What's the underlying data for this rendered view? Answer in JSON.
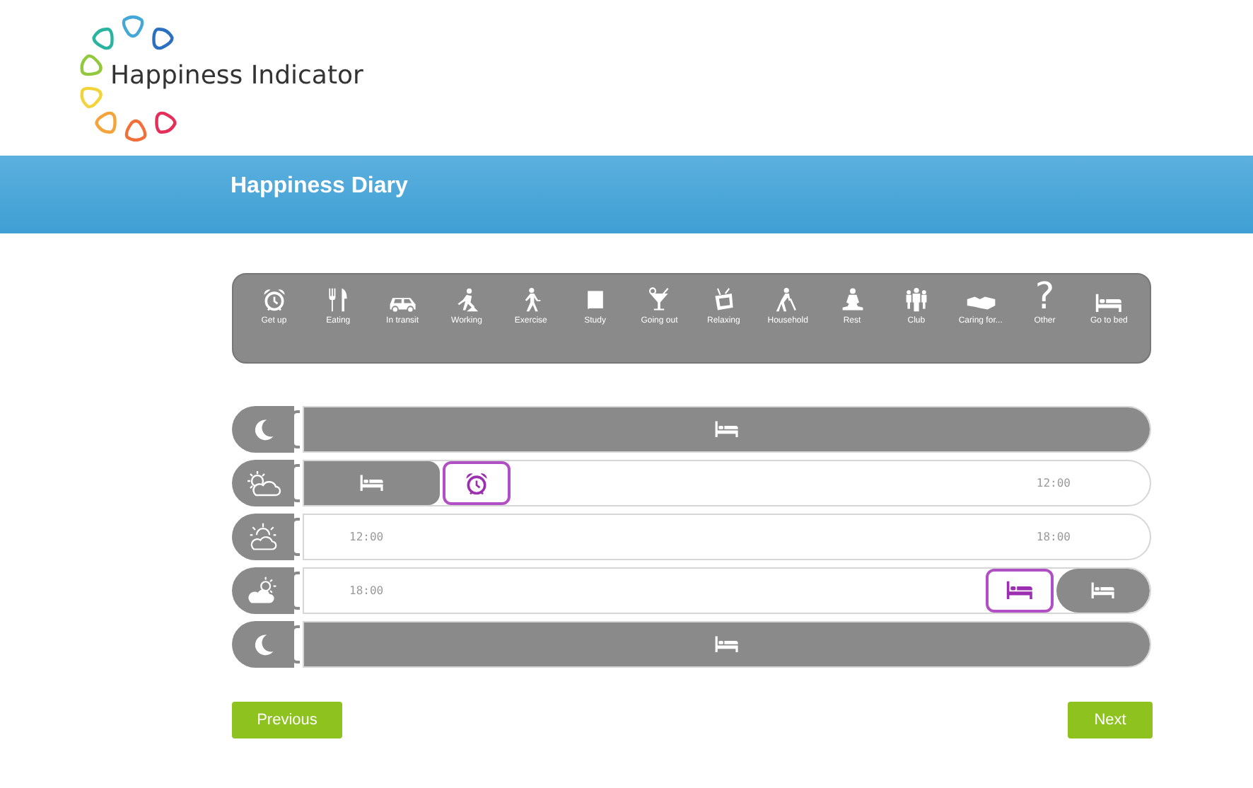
{
  "header": {
    "logo_text": "Happiness Indicator"
  },
  "banner": {
    "title": "Happiness Diary"
  },
  "palette": [
    {
      "kind": "alarm",
      "label": "Get up"
    },
    {
      "kind": "eating",
      "label": "Eating"
    },
    {
      "kind": "car",
      "label": "In transit"
    },
    {
      "kind": "working",
      "label": "Working"
    },
    {
      "kind": "walking",
      "label": "Exercise"
    },
    {
      "kind": "book",
      "label": "Study"
    },
    {
      "kind": "cocktail",
      "label": "Going out"
    },
    {
      "kind": "tv",
      "label": "Relaxing"
    },
    {
      "kind": "household",
      "label": "Household"
    },
    {
      "kind": "rest",
      "label": "Rest"
    },
    {
      "kind": "club",
      "label": "Club"
    },
    {
      "kind": "caring",
      "label": "Caring for..."
    },
    {
      "kind": "glyph",
      "glyph": "?",
      "label": "Other"
    },
    {
      "kind": "bed",
      "label": "Go to bed"
    }
  ],
  "rows": [
    {
      "kind": "night",
      "segments": [
        {
          "kind": "bed",
          "selected": false
        }
      ]
    },
    {
      "kind": "morning",
      "segments": [
        {
          "kind": "bed",
          "selected": false
        },
        {
          "kind": "alarm",
          "selected": true
        },
        {
          "kind": "gap",
          "end_time": "12:00"
        }
      ]
    },
    {
      "kind": "afternoon",
      "segments": [
        {
          "kind": "gap",
          "start_time": "12:00",
          "end_time": "18:00"
        }
      ]
    },
    {
      "kind": "evening",
      "segments": [
        {
          "kind": "gap",
          "start_time": "18:00"
        },
        {
          "kind": "bed",
          "selected": true
        },
        {
          "kind": "bed",
          "selected": false
        }
      ]
    },
    {
      "kind": "night",
      "segments": [
        {
          "kind": "bed",
          "selected": false
        }
      ]
    }
  ],
  "nav": {
    "previous": "Previous",
    "next": "Next"
  }
}
